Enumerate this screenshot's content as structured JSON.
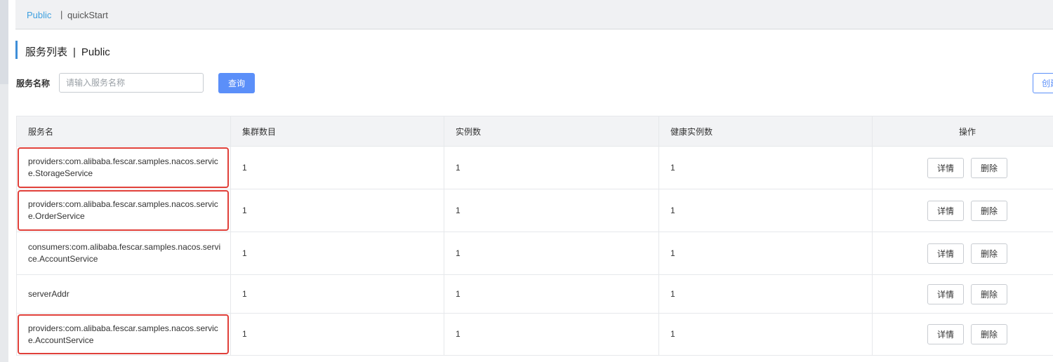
{
  "namespace": {
    "active": "Public",
    "separator": "|",
    "other": "quickStart"
  },
  "page": {
    "title": "服务列表",
    "title_separator": "|",
    "title_namespace": "Public"
  },
  "search": {
    "label": "服务名称",
    "placeholder": "请输入服务名称",
    "query_label": "查询",
    "create_label": "创建服务"
  },
  "table": {
    "headers": [
      "服务名",
      "集群数目",
      "实例数",
      "健康实例数",
      "操作"
    ],
    "rows": [
      {
        "name": "providers:com.alibaba.fescar.samples.nacos.service.StorageService",
        "clusters": "1",
        "instances": "1",
        "healthy": "1",
        "detail": "详情",
        "delete": "删除"
      },
      {
        "name": "providers:com.alibaba.fescar.samples.nacos.service.OrderService",
        "clusters": "1",
        "instances": "1",
        "healthy": "1",
        "detail": "详情",
        "delete": "删除"
      },
      {
        "name": "consumers:com.alibaba.fescar.samples.nacos.service.AccountService",
        "clusters": "1",
        "instances": "1",
        "healthy": "1",
        "detail": "详情",
        "delete": "删除"
      },
      {
        "name": "serverAddr",
        "clusters": "1",
        "instances": "1",
        "healthy": "1",
        "detail": "详情",
        "delete": "删除"
      },
      {
        "name": "providers:com.alibaba.fescar.samples.nacos.service.AccountService",
        "clusters": "1",
        "instances": "1",
        "healthy": "1",
        "detail": "详情",
        "delete": "删除"
      }
    ]
  },
  "colors": {
    "accent": "#5b8ff9",
    "namespace_active": "#3ea0e0",
    "highlight_box": "#e0403a"
  }
}
